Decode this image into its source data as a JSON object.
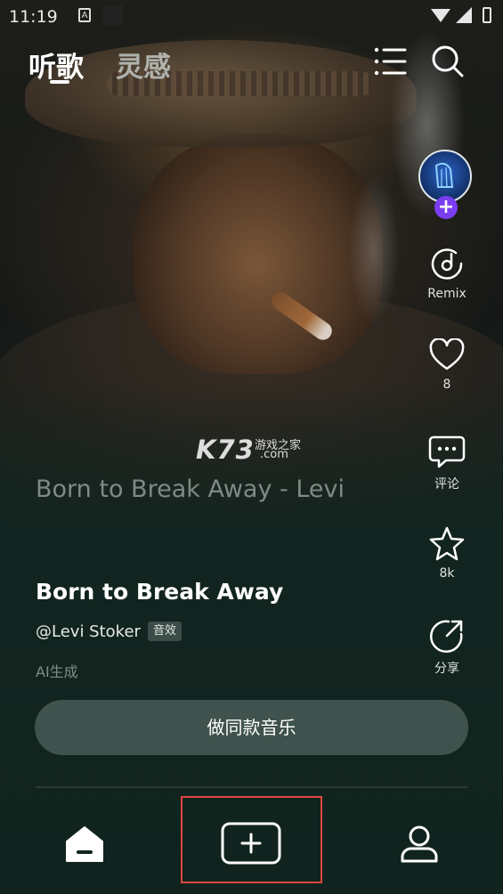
{
  "status_bar": {
    "time": "11:19",
    "notification_letter": "A"
  },
  "header": {
    "tabs": [
      {
        "label": "听歌",
        "active": true
      },
      {
        "label": "灵感",
        "active": false
      }
    ],
    "menu_icon": "list-icon",
    "search_icon": "search-icon"
  },
  "sidebar": {
    "avatar_icon": "harp-avatar",
    "follow_icon": "plus-icon",
    "actions": [
      {
        "icon": "remix-icon",
        "label": "Remix"
      },
      {
        "icon": "heart-icon",
        "label": "8"
      },
      {
        "icon": "comment-icon",
        "label": "评论"
      },
      {
        "icon": "star-icon",
        "label": "8k"
      },
      {
        "icon": "share-icon",
        "label": "分享"
      }
    ]
  },
  "watermark": {
    "brand": "K73",
    "site_cn": "游戏之家",
    "site_domain": ".com"
  },
  "player": {
    "background_title": "Born to Break Away - Levi",
    "title": "Born to Break Away",
    "artist": "@Levi Stoker",
    "tag": "音效",
    "ai_note": "AI生成",
    "make_button": "做同款音乐"
  },
  "bottom_nav": {
    "items": [
      {
        "icon": "home-icon"
      },
      {
        "icon": "add-icon"
      },
      {
        "icon": "profile-icon"
      }
    ]
  },
  "colors": {
    "background": "#11241f",
    "button": "#3f524d",
    "accent_purple": "#7a3df0",
    "highlight_box": "#e0473e"
  }
}
